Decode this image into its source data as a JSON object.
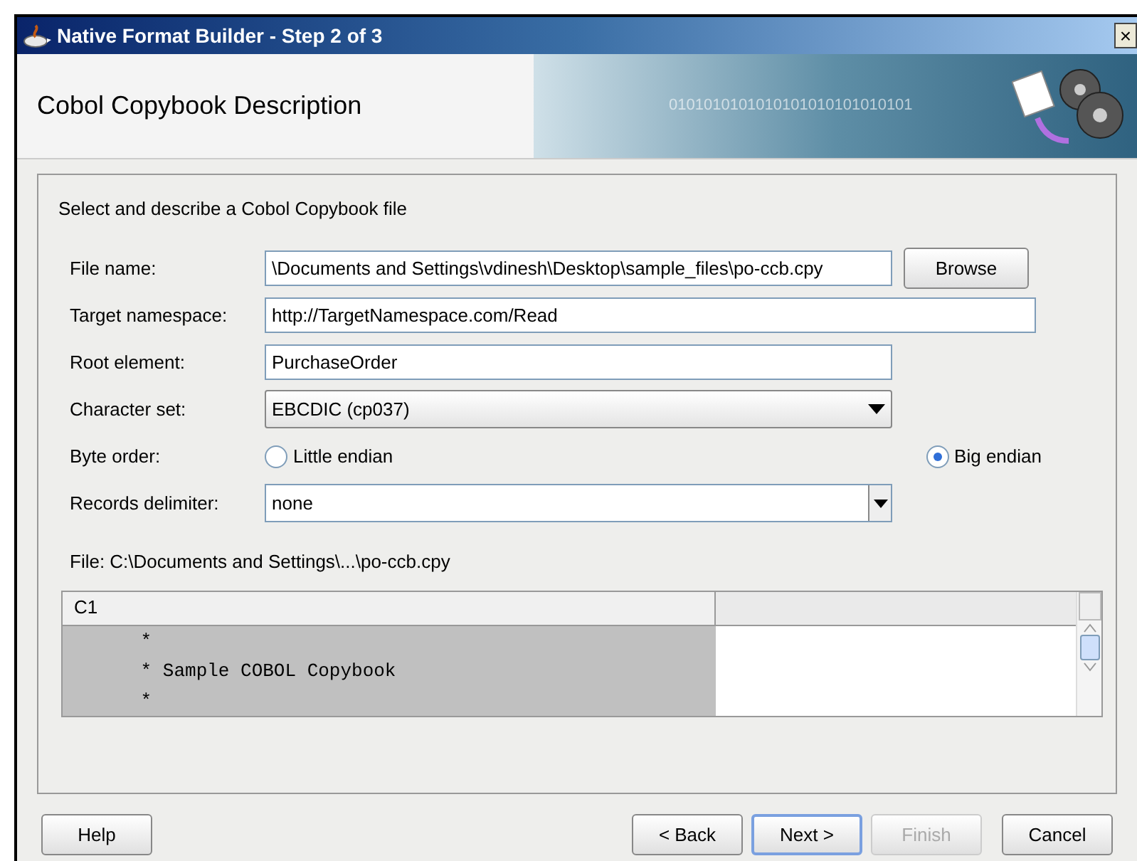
{
  "window": {
    "title": "Native Format Builder - Step 2 of 3",
    "close": "×"
  },
  "header": {
    "title": "Cobol Copybook Description",
    "banner_text": "0101010101010101010101010101"
  },
  "instructions": "Select and describe a Cobol Copybook file",
  "fields": [
    {
      "kind": "text",
      "label": "File name:",
      "value": "\\Documents and Settings\\vdinesh\\Desktop\\sample_files\\po-ccb.cpy",
      "button": "Browse",
      "wide": false
    },
    {
      "kind": "text",
      "label": "Target namespace:",
      "value": "http://TargetNamespace.com/Read",
      "wide": true
    },
    {
      "kind": "text",
      "label": "Root element:",
      "value": "PurchaseOrder",
      "wide": false
    },
    {
      "kind": "select",
      "label": "Character set:",
      "value": "EBCDIC (cp037)"
    },
    {
      "kind": "radio",
      "label": "Byte order:",
      "options": [
        {
          "label": "Little endian",
          "selected": false
        },
        {
          "label": "Big endian",
          "selected": true
        }
      ]
    },
    {
      "kind": "combo",
      "label": "Records delimiter:",
      "value": "none"
    }
  ],
  "file_label": "File: C:\\Documents and Settings\\...\\po-ccb.cpy",
  "table": {
    "columns": [
      "C1"
    ],
    "rows": [
      "      *",
      "      * Sample COBOL Copybook",
      "      *"
    ]
  },
  "buttons": [
    {
      "label": "Help",
      "disabled": false,
      "default": false
    },
    {
      "label": "< Back",
      "disabled": false,
      "default": false
    },
    {
      "label": "Next >",
      "disabled": false,
      "default": true
    },
    {
      "label": "Finish",
      "disabled": true,
      "default": false
    },
    {
      "label": "Cancel",
      "disabled": false,
      "default": false
    }
  ]
}
